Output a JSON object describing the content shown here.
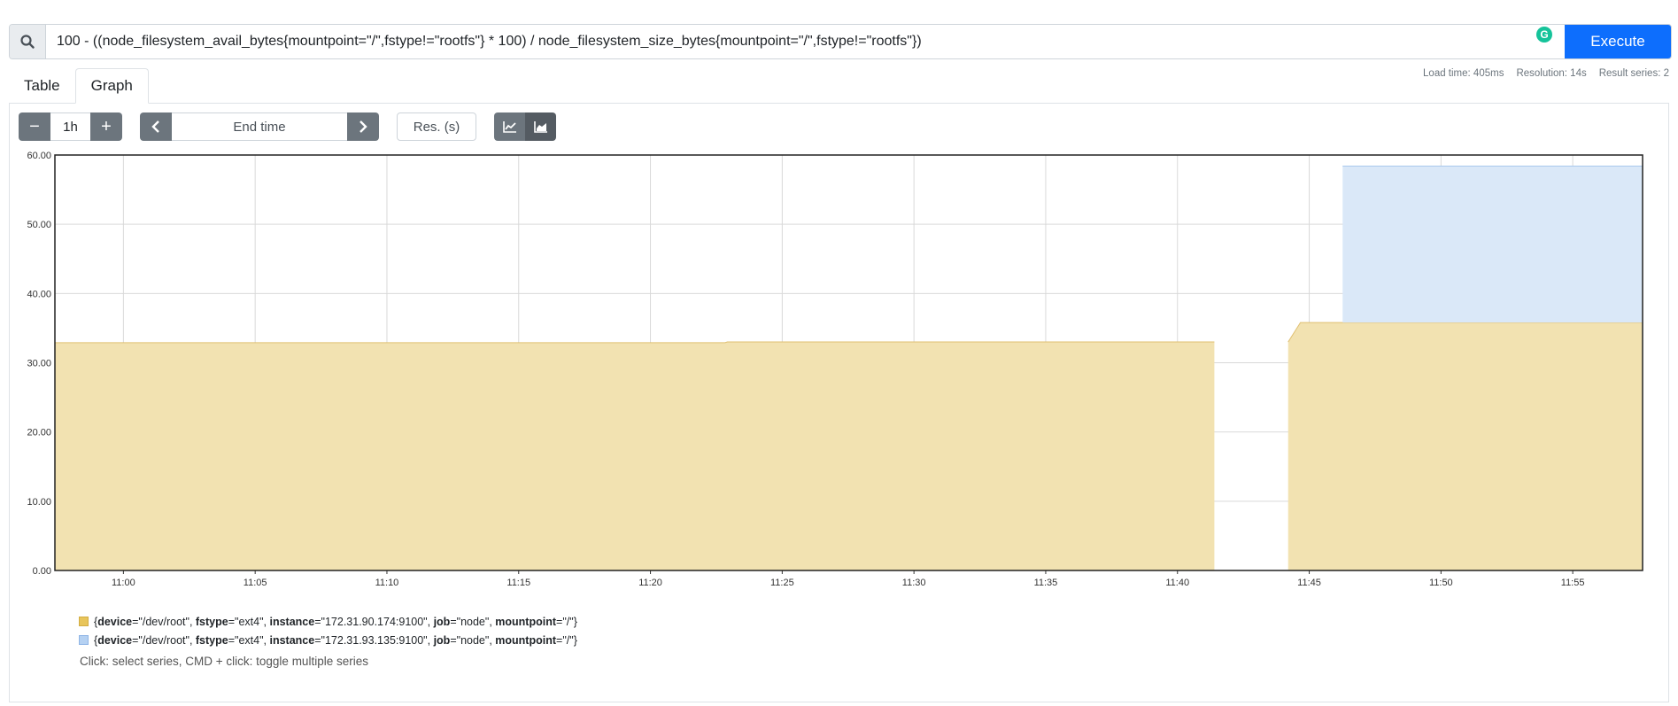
{
  "query": {
    "text": "100 - ((node_filesystem_avail_bytes{mountpoint=\"/\",fstype!=\"rootfs\"} * 100) / node_filesystem_size_bytes{mountpoint=\"/\",fstype!=\"rootfs\"})",
    "execute_label": "Execute",
    "search_icon": "search-icon",
    "grammarly_icon": "grammarly-icon"
  },
  "tabs": [
    {
      "label": "Table",
      "active": false
    },
    {
      "label": "Graph",
      "active": true
    }
  ],
  "stats": {
    "load_time": "Load time: 405ms",
    "resolution": "Resolution: 14s",
    "result_series": "Result series: 2"
  },
  "controls": {
    "decrease": "−",
    "range": "1h",
    "increase": "+",
    "end_time_placeholder": "End time",
    "resolution_placeholder": "Res. (s)"
  },
  "colors": {
    "series1_fill": "#f2e2b1",
    "series1_line": "#e0c071",
    "series2_fill": "#dae8f8",
    "series2_line": "#a9c8ec",
    "accent": "#0d6efd"
  },
  "chart_data": {
    "type": "area",
    "stacked": true,
    "ylim": [
      0,
      60
    ],
    "yticks": [
      "0.00",
      "10.00",
      "20.00",
      "30.00",
      "40.00",
      "50.00",
      "60.00"
    ],
    "xticks": [
      "11:00",
      "11:05",
      "11:10",
      "11:15",
      "11:20",
      "11:25",
      "11:30",
      "11:35",
      "11:40",
      "11:45",
      "11:50",
      "11:55"
    ],
    "x_range": [
      "10:57:24",
      "11:57:39"
    ],
    "grid": true,
    "series": [
      {
        "name": "{device=\"/dev/root\", fstype=\"ext4\", instance=\"172.31.90.174:9100\", job=\"node\", mountpoint=\"/\"}",
        "segments": [
          [
            [
              "10:57:24",
              32.9
            ],
            [
              "11:22:50",
              32.9
            ],
            [
              "11:22:55",
              33.0
            ],
            [
              "11:41:24",
              33.0
            ]
          ],
          [
            [
              "11:44:12",
              33.0
            ],
            [
              "11:44:40",
              35.8
            ],
            [
              "11:57:39",
              35.8
            ]
          ]
        ]
      },
      {
        "name": "{device=\"/dev/root\", fstype=\"ext4\", instance=\"172.31.93.135:9100\", job=\"node\", mountpoint=\"/\"}",
        "segments": [
          [
            [
              "11:46:16",
              22.6
            ],
            [
              "11:57:39",
              22.6
            ]
          ]
        ]
      }
    ]
  },
  "legend": {
    "items": [
      {
        "device": "\"/dev/root\"",
        "fstype": "\"ext4\"",
        "instance": "\"172.31.90.174:9100\"",
        "job": "\"node\"",
        "mountpoint": "\"/\""
      },
      {
        "device": "\"/dev/root\"",
        "fstype": "\"ext4\"",
        "instance": "\"172.31.93.135:9100\"",
        "job": "\"node\"",
        "mountpoint": "\"/\""
      }
    ],
    "hint": "Click: select series, CMD + click: toggle multiple series"
  }
}
